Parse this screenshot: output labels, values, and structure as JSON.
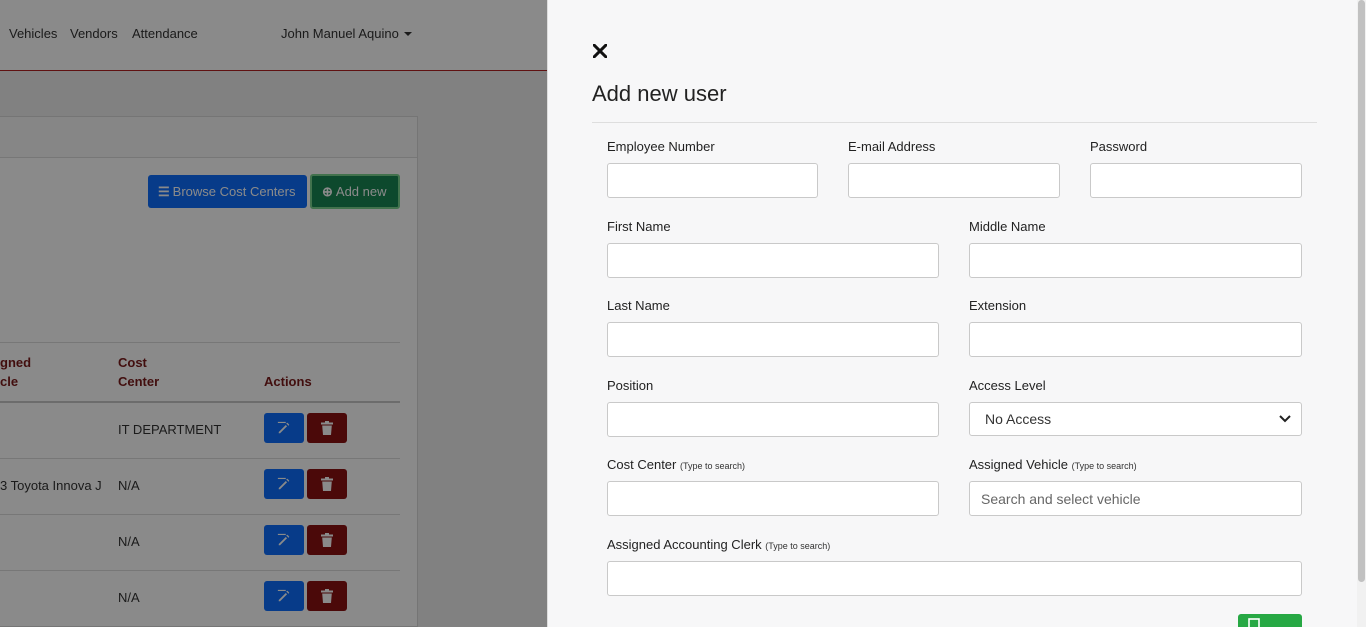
{
  "nav": {
    "links": [
      "Vehicles",
      "Vendors",
      "Attendance"
    ],
    "user_name": "John Manuel Aquino"
  },
  "background": {
    "browse_button": "Browse Cost Centers",
    "add_button": "Add new",
    "table": {
      "headers": {
        "assigned_line1": "gned",
        "assigned_line2": "cle",
        "cost_line1": "Cost",
        "cost_line2": "Center",
        "actions": "Actions"
      },
      "rows": [
        {
          "vehicle": "",
          "cost_center": "IT DEPARTMENT"
        },
        {
          "vehicle": "3 Toyota Innova J",
          "cost_center": "N/A"
        },
        {
          "vehicle": "",
          "cost_center": "N/A"
        },
        {
          "vehicle": "",
          "cost_center": "N/A"
        }
      ]
    }
  },
  "modal": {
    "title": "Add new user",
    "fields": {
      "employee_number": {
        "label": "Employee Number",
        "value": ""
      },
      "email": {
        "label": "E-mail Address",
        "value": ""
      },
      "password": {
        "label": "Password",
        "value": ""
      },
      "first_name": {
        "label": "First Name",
        "value": ""
      },
      "middle_name": {
        "label": "Middle Name",
        "value": ""
      },
      "last_name": {
        "label": "Last Name",
        "value": ""
      },
      "extension": {
        "label": "Extension",
        "value": ""
      },
      "position": {
        "label": "Position",
        "value": ""
      },
      "access_level": {
        "label": "Access Level",
        "selected": "No Access"
      },
      "cost_center": {
        "label": "Cost Center",
        "hint": "(Type to search)",
        "value": ""
      },
      "assigned_vehicle": {
        "label": "Assigned Vehicle",
        "hint": "(Type to search)",
        "placeholder": "Search and select vehicle"
      },
      "accounting_clerk": {
        "label": "Assigned Accounting Clerk",
        "hint": "(Type to search)",
        "value": ""
      }
    }
  },
  "colors": {
    "primary": "#0d6efd",
    "success": "#198754",
    "danger": "#8b1111",
    "header_text": "#7a1a1a",
    "nav_border": "#b22222"
  },
  "icons": {
    "close": "close-icon",
    "browse": "list-icon",
    "add": "plus-circle-icon",
    "edit": "edit-icon",
    "delete": "trash-icon",
    "dropdown": "chevron-down-icon"
  }
}
